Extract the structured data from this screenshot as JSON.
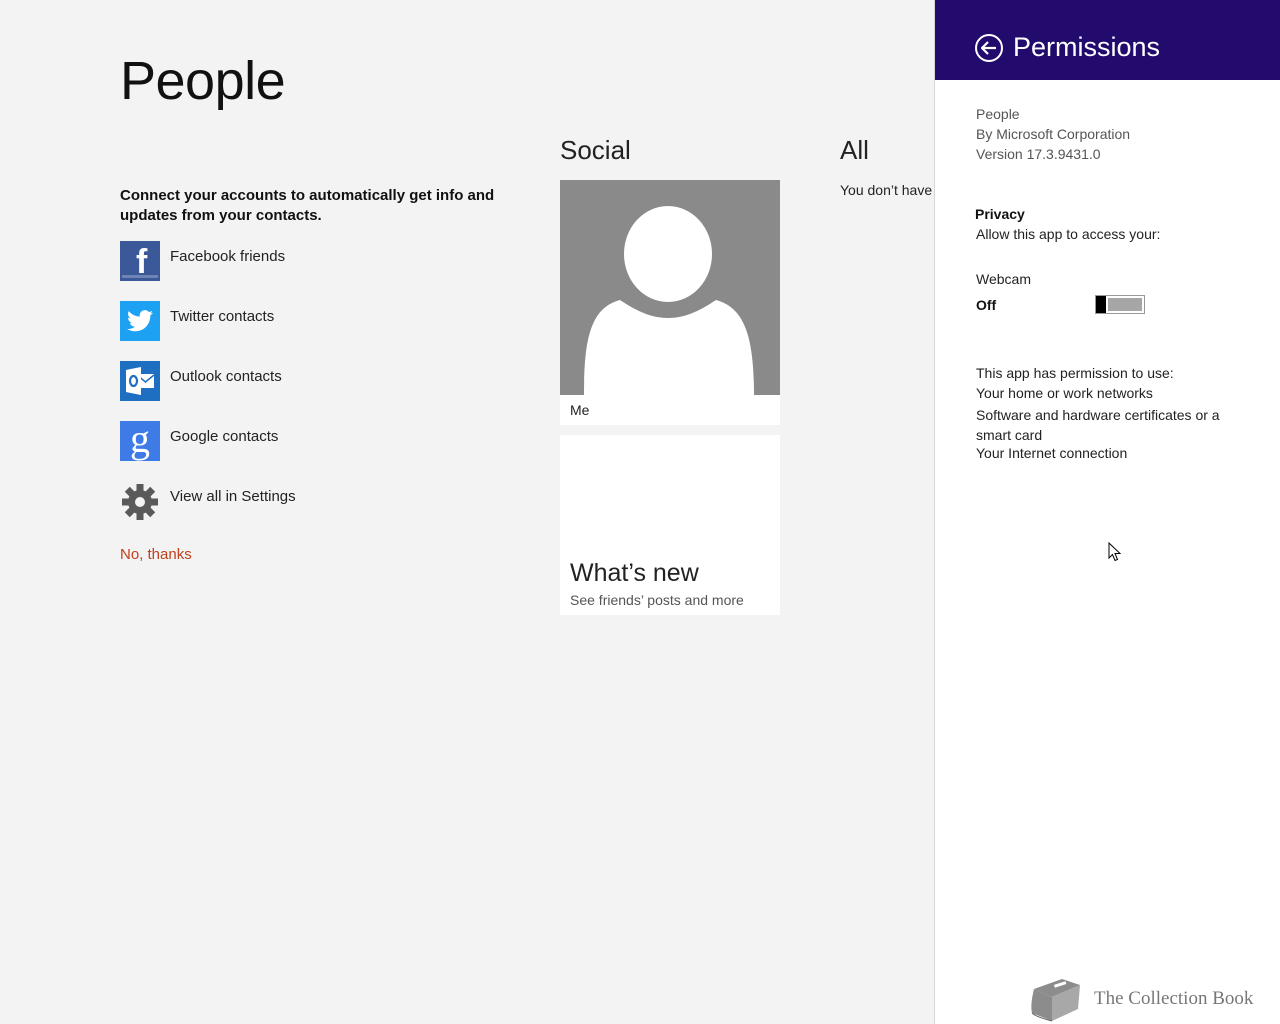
{
  "app": {
    "title": "People"
  },
  "connect": {
    "message": "Connect your accounts to automatically get info and updates from your contacts.",
    "accounts": [
      {
        "label": "Facebook friends",
        "icon": "facebook-icon",
        "color": "#3b5998"
      },
      {
        "label": "Twitter contacts",
        "icon": "twitter-icon",
        "color": "#1da1f2"
      },
      {
        "label": "Outlook contacts",
        "icon": "outlook-icon",
        "color": "#1e6fc2"
      },
      {
        "label": "Google contacts",
        "icon": "google-icon",
        "color": "#3f7be6"
      },
      {
        "label": "View all in Settings",
        "icon": "gear-icon",
        "color": "#555555"
      }
    ],
    "decline": "No, thanks"
  },
  "social": {
    "title": "Social",
    "me_tile": {
      "label": "Me"
    },
    "whats_new": {
      "title": "What’s new",
      "subtitle": "See friends’ posts and more"
    }
  },
  "all": {
    "title": "All",
    "empty_text": "You don’t have"
  },
  "permissions": {
    "title": "Permissions",
    "app_name": "People",
    "publisher": "By Microsoft Corporation",
    "version": "Version 17.3.9431.0",
    "privacy_heading": "Privacy",
    "privacy_desc": "Allow this app to access your:",
    "webcam_label": "Webcam",
    "webcam_state": "Off",
    "uses_heading": "This app has permission to use:",
    "uses": [
      "Your home or work networks",
      "Software and hardware certificates or a smart card",
      "Your Internet connection"
    ],
    "header_color": "#230b6e"
  },
  "watermark": {
    "text": "The Collection Book"
  }
}
